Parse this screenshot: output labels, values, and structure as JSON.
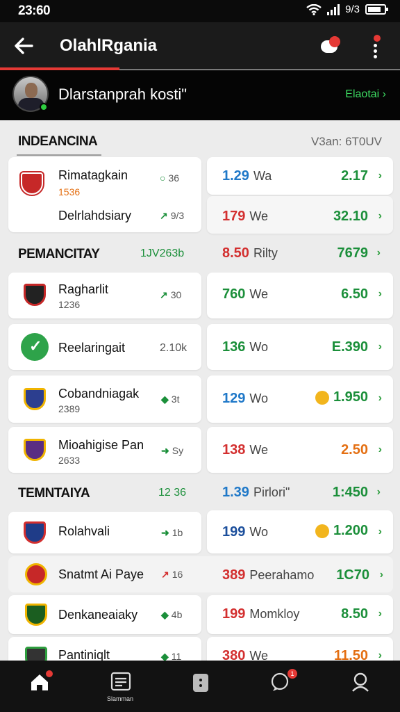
{
  "status": {
    "time": "23:60",
    "right_text": "9/3"
  },
  "appbar": {
    "title": "OlahlRgania",
    "back_icon": "arrow-left-icon",
    "notify_icon": "chat-icon",
    "more_icon": "more-vertical-icon"
  },
  "profile": {
    "name": "Dlarstanprah kosti\"",
    "link": "Elaotai ›"
  },
  "sections": [
    {
      "label": "INDEANCINA",
      "sub": "V3an: 6T0UV"
    },
    {
      "label": "PEMANCITAY",
      "sub": "1JV263b",
      "odd": "8.50",
      "odd_label": "Rilty",
      "value": "7679"
    },
    {
      "label": "TEMNTAIYA",
      "sub": "12 36",
      "odd": "1.39",
      "odd_label": "Pirlori\"",
      "value": "1:450"
    }
  ],
  "rows": [
    {
      "team": "Rimatagkain",
      "meta": "1536",
      "trend": "36",
      "odd": "1.29",
      "odd_label": "Wa",
      "value": "2.17"
    },
    {
      "team": "Delrlahdsiary",
      "meta": "",
      "trend": "9/3",
      "odd": "179",
      "odd_label": "We",
      "value": "32.10"
    },
    {
      "team": "Ragharlit",
      "meta": "1236",
      "trend": "30",
      "odd": "760",
      "odd_label": "We",
      "value": "6.50"
    },
    {
      "team": "Reelaringait",
      "meta": "",
      "trend": "2.10k",
      "odd": "136",
      "odd_label": "Wo",
      "value": "E.390"
    },
    {
      "team": "Cobandniagak",
      "meta": "2389",
      "trend": "3t",
      "odd": "129",
      "odd_label": "Wo",
      "value": "1.950"
    },
    {
      "team": "Mioahigise Pan",
      "meta": "2633",
      "trend": "Sy",
      "odd": "138",
      "odd_label": "We",
      "value": "2.50"
    },
    {
      "team": "Rolahvali",
      "meta": "",
      "trend": "1b",
      "odd": "199",
      "odd_label": "Wo",
      "value": "1.200"
    },
    {
      "team": "Snatmt Ai Paye",
      "meta": "",
      "trend": "16",
      "odd": "389",
      "odd_label": "Peerahamo",
      "value": "1C70"
    },
    {
      "team": "Denkaneaiaky",
      "meta": "",
      "trend": "4b",
      "odd": "199",
      "odd_label": "Momkloy",
      "value": "8.50"
    },
    {
      "team": "Pantiniqlt",
      "meta": "",
      "trend": "11",
      "odd": "380",
      "odd_label": "We",
      "value": "11.50"
    }
  ],
  "nav": [
    {
      "label": "",
      "icon": "home-icon",
      "badge": ""
    },
    {
      "label": "Slamman",
      "icon": "news-icon",
      "badge": ""
    },
    {
      "label": "",
      "icon": "wallet-icon",
      "badge": ""
    },
    {
      "label": "",
      "icon": "chat-icon",
      "badge": "1"
    },
    {
      "label": "",
      "icon": "search-icon",
      "badge": ""
    }
  ]
}
